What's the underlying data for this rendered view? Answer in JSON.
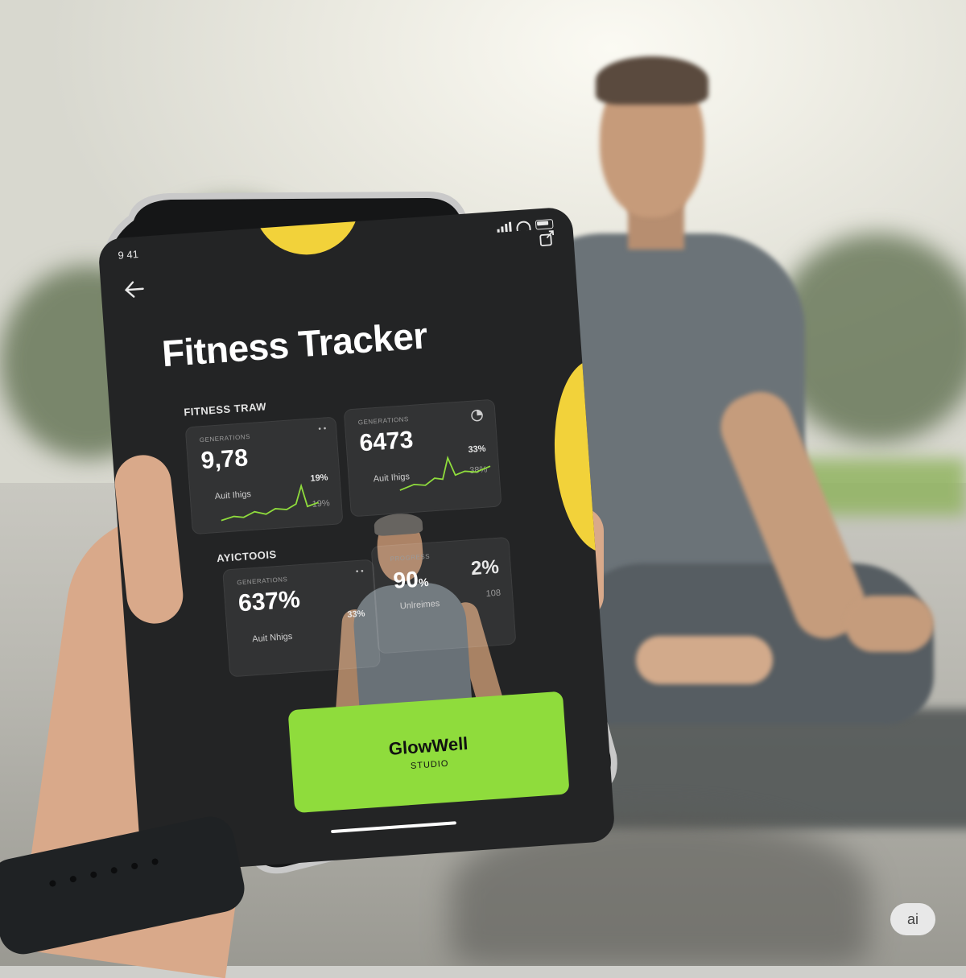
{
  "status_bar": {
    "time": "9 41"
  },
  "header": {
    "back_icon": "arrow-left-icon",
    "action_icon": "share-icon"
  },
  "title": "Fitness Tracker",
  "sections": {
    "first_label": "FITNESS TRAW",
    "second_label": "AYICTOOIS"
  },
  "cards": [
    {
      "caption": "GENERATIONS",
      "value": "9,78",
      "sub": "Auit Ihigs",
      "pct": "19%",
      "pct2": "19%",
      "menu": "• •"
    },
    {
      "caption": "GENERATIONS",
      "value": "6473",
      "sub": "Auit Ihigs",
      "pct": "33%",
      "pct2": "38%",
      "icon": "pie-chart-icon"
    },
    {
      "caption": "GENERATIONS",
      "value": "637%",
      "sub": "Auit Nhigs",
      "pct": "33%",
      "menu": "• •"
    },
    {
      "caption": "PROGRESS",
      "value": "90",
      "value_suffix": "%",
      "sub": "Unlreimes",
      "pct": "2%",
      "pct2": "108"
    }
  ],
  "cta": {
    "title": "GlowWell",
    "subtitle": "STUDIO"
  },
  "badge": {
    "label": "ai"
  },
  "colors": {
    "accent_yellow": "#f2d23a",
    "accent_green": "#8fdc3c",
    "screen_bg": "#232425"
  }
}
